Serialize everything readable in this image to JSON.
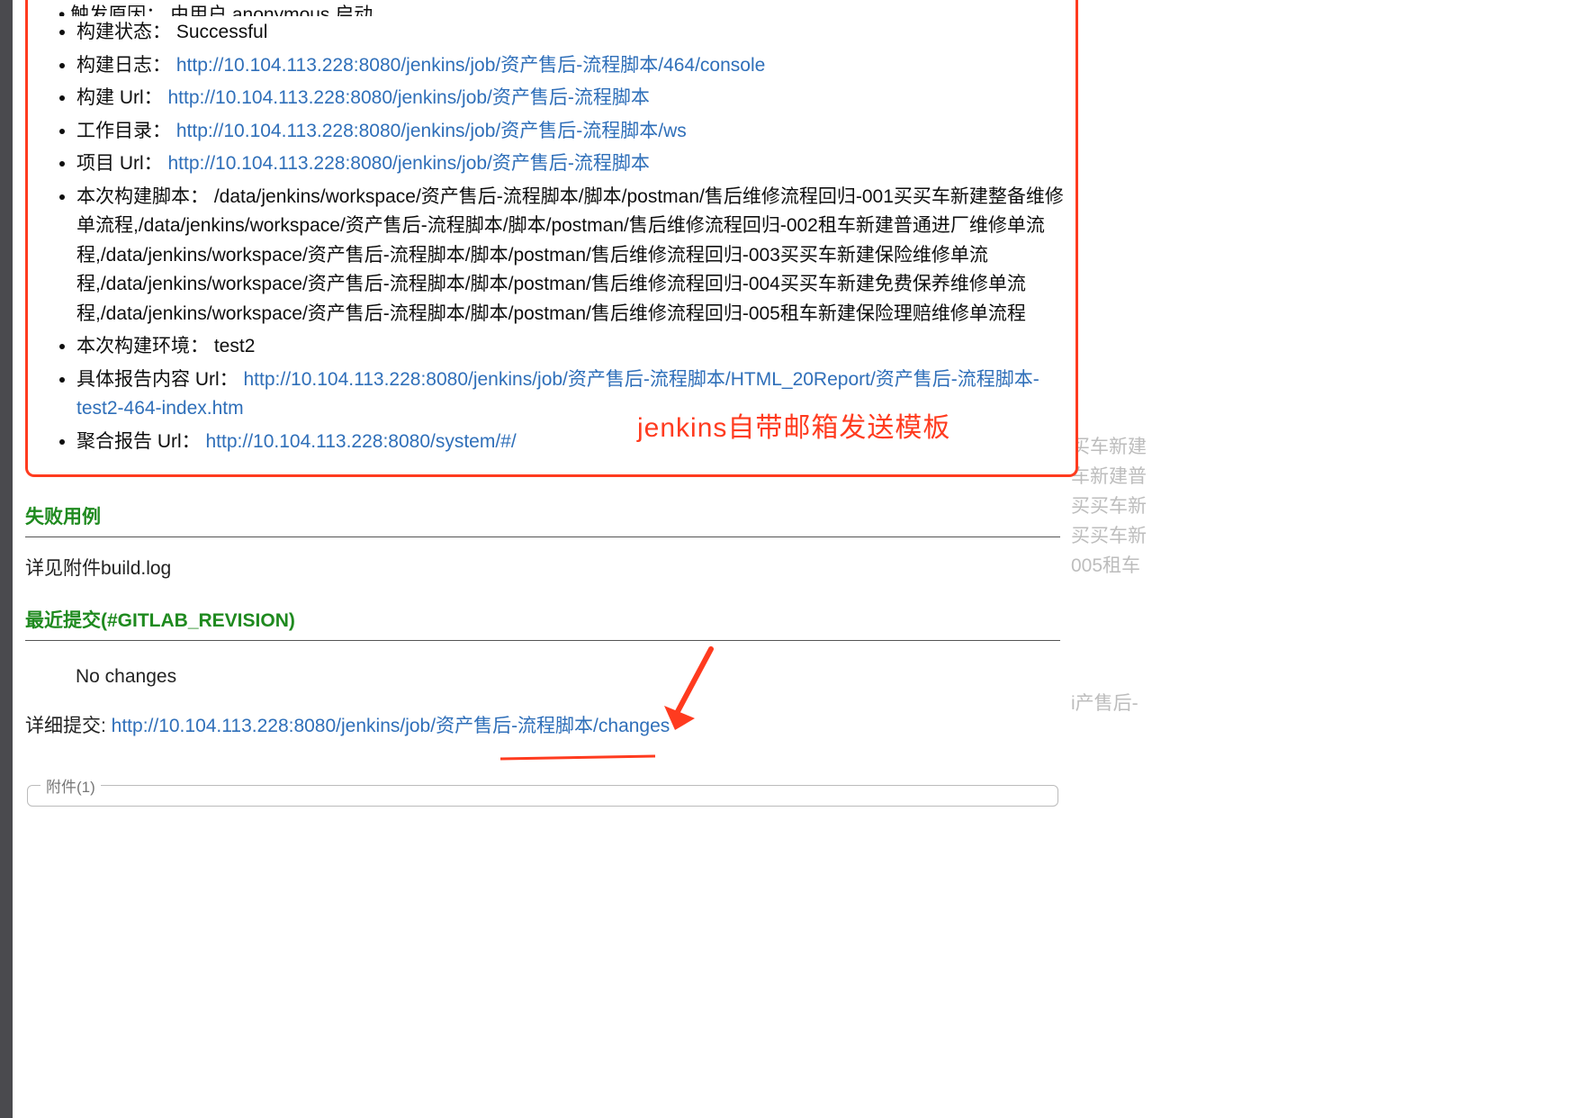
{
  "cutoff_line": "触发原因：  由用户 anonymous 启动",
  "items": [
    {
      "label": "构建状态：",
      "value": "Successful",
      "isLink": false
    },
    {
      "label": "构建日志：",
      "url": "http://10.104.113.228:8080/jenkins/job/资产售后-流程脚本/464/console"
    },
    {
      "label": "构建 Url：",
      "url": "http://10.104.113.228:8080/jenkins/job/资产售后-流程脚本"
    },
    {
      "label": "工作目录：",
      "url": "http://10.104.113.228:8080/jenkins/job/资产售后-流程脚本/ws"
    },
    {
      "label": "项目 Url：",
      "url": "http://10.104.113.228:8080/jenkins/job/资产售后-流程脚本"
    },
    {
      "label": "本次构建脚本：",
      "value": "/data/jenkins/workspace/资产售后-流程脚本/脚本/postman/售后维修流程回归-001买买车新建整备维修单流程,/data/jenkins/workspace/资产售后-流程脚本/脚本/postman/售后维修流程回归-002租车新建普通进厂维修单流程,/data/jenkins/workspace/资产售后-流程脚本/脚本/postman/售后维修流程回归-003买买车新建保险维修单流程,/data/jenkins/workspace/资产售后-流程脚本/脚本/postman/售后维修流程回归-004买买车新建免费保养维修单流程,/data/jenkins/workspace/资产售后-流程脚本/脚本/postman/售后维修流程回归-005租车新建保险理赔维修单流程",
      "isLink": false
    },
    {
      "label": "本次构建环境：",
      "value": "test2",
      "isLink": false
    },
    {
      "label": "具体报告内容 Url：",
      "url": "http://10.104.113.228:8080/jenkins/job/资产售后-流程脚本/HTML_20Report/资产售后-流程脚本-test2-464-index.htm"
    },
    {
      "label": "聚合报告 Url：",
      "url": "http://10.104.113.228:8080/system/#/"
    }
  ],
  "annotation": "jenkins自带邮箱发送模板",
  "section_failed": "失败用例",
  "see_attachment": "详见附件build.log",
  "section_commits": "最近提交(#GITLAB_REVISION)",
  "no_changes": "No changes",
  "detail_label": "详细提交: ",
  "detail_url": "http://10.104.113.228:8080/jenkins/job/资产售后-流程脚本/changes",
  "attachments_label": "附件(1)",
  "ghost_lines": [
    "买车新建",
    "车新建普",
    "买买车新",
    "买买车新",
    "005租车",
    "",
    "",
    "",
    "i产售后-"
  ]
}
